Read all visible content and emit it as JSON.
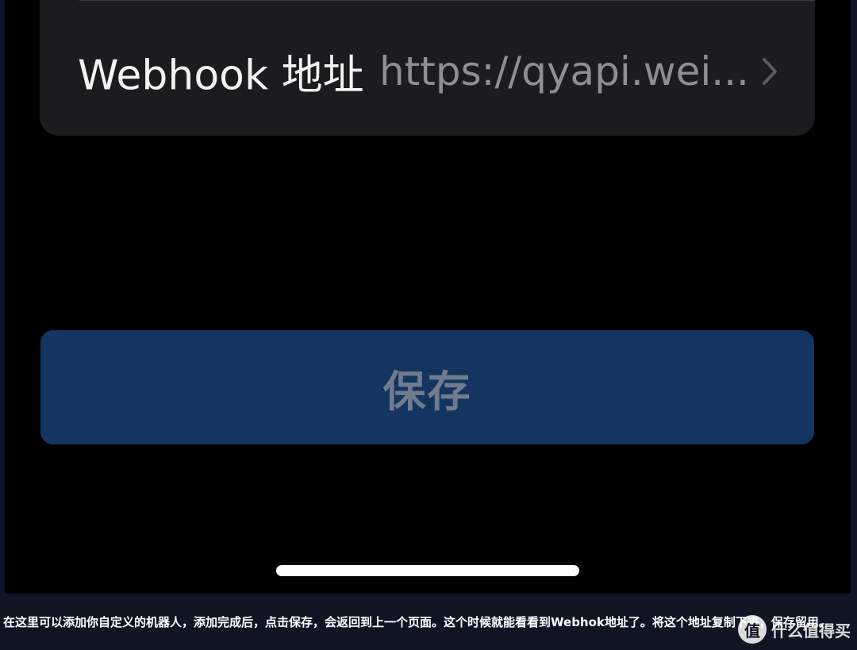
{
  "settings": {
    "webhook_label": "Webhook 地址",
    "webhook_value": "https://qyapi.wei..."
  },
  "save_button": {
    "label": "保存"
  },
  "caption": {
    "text": "在这里可以添加你自定义的机器人，添加完成后，点击保存，会返回到上一个页面。这个时候就能看看到Webhok地址了。将这个地址复制下来，保存留用。"
  },
  "watermark": {
    "badge": "值",
    "text": "什么值得买"
  },
  "icons": {
    "chevron": "chevron-right-icon"
  },
  "colors": {
    "button_background": "#14355f",
    "card_background": "#1c1c1e",
    "page_background": "#000000"
  }
}
